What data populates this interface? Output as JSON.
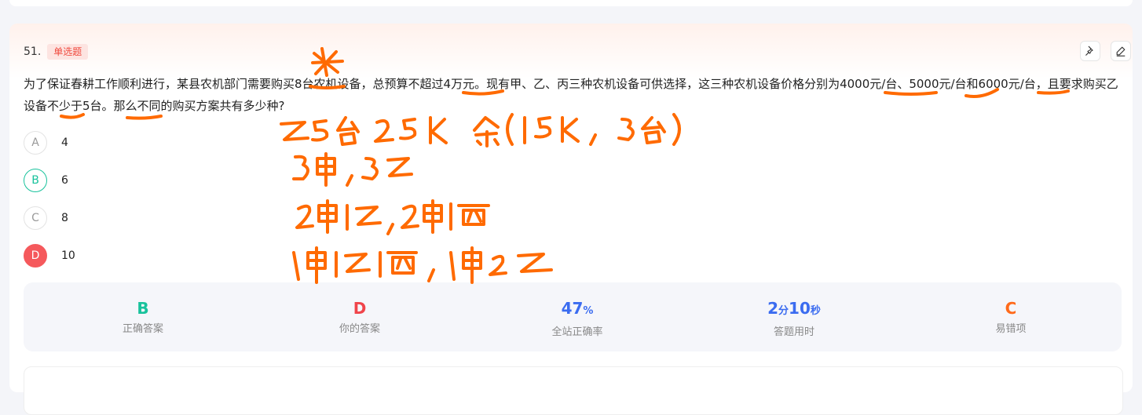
{
  "question": {
    "number": "51.",
    "type": "单选题",
    "stem": "为了保证春耕工作顺利进行，某县农机部门需要购买8台农机设备，总预算不超过4万元。现有甲、乙、丙三种农机设备可供选择，这三种农机设备价格分别为4000元/台、5000元/台和6000元/台，且要求购买乙设备不少于5台。那么不同的购买方案共有多少种?"
  },
  "options": [
    {
      "letter": "A",
      "text": "4",
      "state": "normal"
    },
    {
      "letter": "B",
      "text": "6",
      "state": "correct"
    },
    {
      "letter": "C",
      "text": "8",
      "state": "normal"
    },
    {
      "letter": "D",
      "text": "10",
      "state": "wrong"
    }
  ],
  "stats": {
    "correct_answer": {
      "value": "B",
      "label": "正确答案",
      "color": "#18c29c"
    },
    "your_answer": {
      "value": "D",
      "label": "你的答案",
      "color": "#f0444a"
    },
    "accuracy": {
      "value": "47",
      "unit": "%",
      "label": "全站正确率",
      "color": "#3b6cf0"
    },
    "time": {
      "min": "2",
      "min_unit": "分",
      "sec": "10",
      "sec_unit": "秒",
      "label": "答题用时",
      "color": "#3b6cf0"
    },
    "common_wrong": {
      "value": "C",
      "label": "易错项",
      "color": "#ff6a1a"
    }
  },
  "tools": [
    {
      "icon": "pin-icon"
    },
    {
      "icon": "edit-icon"
    }
  ],
  "annotations": {
    "color": "#ff6a00",
    "lines": [
      "乙5台25K 余(15K, 3台)",
      "3甲, 3乙",
      "2甲1乙, 2甲1丙",
      "1甲1乙1丙, 1甲2乙"
    ]
  }
}
